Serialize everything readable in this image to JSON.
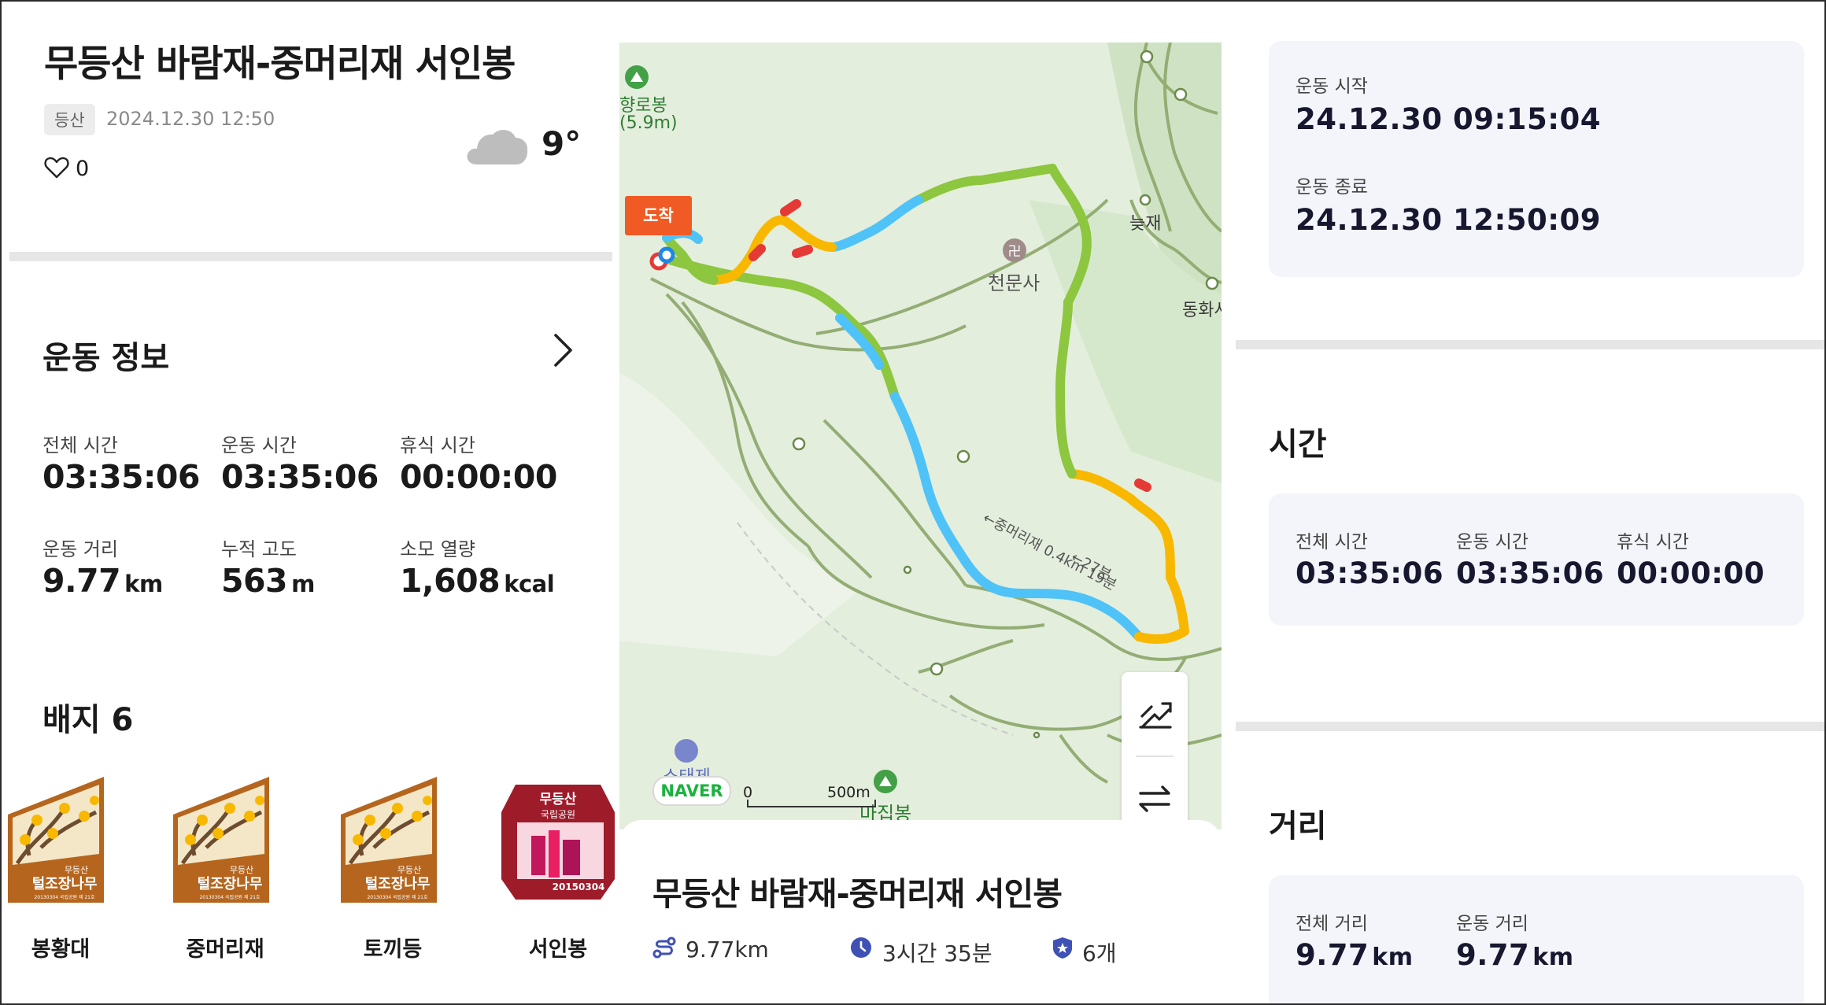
{
  "activity": {
    "title": "무등산 바람재-중머리재 서인봉",
    "tag": "등산",
    "datetime": "2024.12.30 12:50",
    "likes": "0",
    "weather_icon": "cloud-icon",
    "temperature": "9°"
  },
  "workout": {
    "title": "운동 정보",
    "stats": [
      {
        "label": "전체 시간",
        "value": "03:35:06",
        "unit": ""
      },
      {
        "label": "운동 시간",
        "value": "03:35:06",
        "unit": ""
      },
      {
        "label": "휴식 시간",
        "value": "00:00:00",
        "unit": ""
      },
      {
        "label": "운동 거리",
        "value": "9.77",
        "unit": "km"
      },
      {
        "label": "누적 고도",
        "value": "563",
        "unit": "m"
      },
      {
        "label": "소모 열량",
        "value": "1,608",
        "unit": "kcal"
      }
    ]
  },
  "badges": {
    "title": "배지 6",
    "items": [
      {
        "label": "봉황대",
        "badge_text": "털조장나무",
        "badge_sub": "무등산"
      },
      {
        "label": "중머리재",
        "badge_text": "털조장나무",
        "badge_sub": "무등산"
      },
      {
        "label": "토끼등",
        "badge_text": "털조장나무",
        "badge_sub": "무등산"
      },
      {
        "label": "서인봉",
        "badge_text": "무등산",
        "badge_sub": "국립공원",
        "badge_date": "20150304"
      }
    ],
    "small_print": "20130304 국립공원 제 21호"
  },
  "map": {
    "arrival_label": "도착",
    "pois": {
      "hyangrobong": "향로봉",
      "hyangrobong_elev": "(5.9m)",
      "cheonmunsa": "천문사",
      "neutjae": "늦재",
      "donghwasa": "동화사",
      "majipbong": "마집봉",
      "sotaeje": "소태제"
    },
    "trail_label": "←중머리재 0.4km 19분",
    "trail_label_2": "←27분",
    "naver": "NAVER",
    "scale_start": "0",
    "scale_end": "500m",
    "controls": [
      "elevation-icon",
      "swap-icon"
    ]
  },
  "route": {
    "title": "무등산 바람재-중머리재 서인봉",
    "distance": "9.77km",
    "duration": "3시간 35분",
    "badge_count": "6개"
  },
  "times_card": {
    "start_label": "운동 시작",
    "start_value": "24.12.30 09:15:04",
    "end_label": "운동 종료",
    "end_value": "24.12.30 12:50:09"
  },
  "time_section": {
    "title": "시간",
    "stats": [
      {
        "label": "전체 시간",
        "value": "03:35:06"
      },
      {
        "label": "운동 시간",
        "value": "03:35:06"
      },
      {
        "label": "휴식 시간",
        "value": "00:00:00"
      }
    ]
  },
  "distance_section": {
    "title": "거리",
    "stats": [
      {
        "label": "전체 거리",
        "value": "9.77",
        "unit": "km"
      },
      {
        "label": "운동 거리",
        "value": "9.77",
        "unit": "km"
      }
    ]
  },
  "colors": {
    "accent_orange": "#f05a24",
    "trail_green": "#8dc63f",
    "trail_blue": "#4fc3f7",
    "trail_yellow": "#f9b800",
    "trail_red": "#e53935",
    "card_bg": "#f3f5fa",
    "value_navy": "#17182f"
  }
}
